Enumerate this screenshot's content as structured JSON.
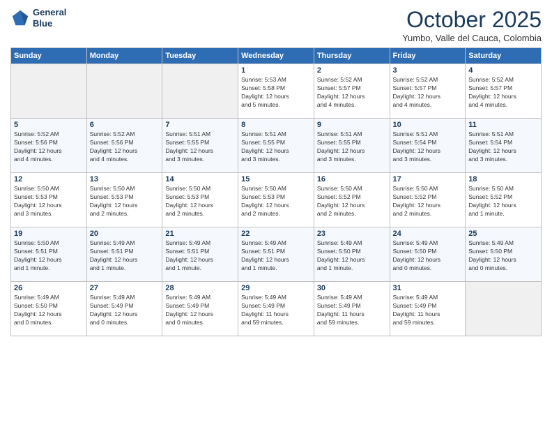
{
  "logo": {
    "line1": "General",
    "line2": "Blue"
  },
  "title": "October 2025",
  "subtitle": "Yumbo, Valle del Cauca, Colombia",
  "days_of_week": [
    "Sunday",
    "Monday",
    "Tuesday",
    "Wednesday",
    "Thursday",
    "Friday",
    "Saturday"
  ],
  "weeks": [
    [
      {
        "day": "",
        "detail": ""
      },
      {
        "day": "",
        "detail": ""
      },
      {
        "day": "",
        "detail": ""
      },
      {
        "day": "1",
        "detail": "Sunrise: 5:53 AM\nSunset: 5:58 PM\nDaylight: 12 hours\nand 5 minutes."
      },
      {
        "day": "2",
        "detail": "Sunrise: 5:52 AM\nSunset: 5:57 PM\nDaylight: 12 hours\nand 4 minutes."
      },
      {
        "day": "3",
        "detail": "Sunrise: 5:52 AM\nSunset: 5:57 PM\nDaylight: 12 hours\nand 4 minutes."
      },
      {
        "day": "4",
        "detail": "Sunrise: 5:52 AM\nSunset: 5:57 PM\nDaylight: 12 hours\nand 4 minutes."
      }
    ],
    [
      {
        "day": "5",
        "detail": "Sunrise: 5:52 AM\nSunset: 5:56 PM\nDaylight: 12 hours\nand 4 minutes."
      },
      {
        "day": "6",
        "detail": "Sunrise: 5:52 AM\nSunset: 5:56 PM\nDaylight: 12 hours\nand 4 minutes."
      },
      {
        "day": "7",
        "detail": "Sunrise: 5:51 AM\nSunset: 5:55 PM\nDaylight: 12 hours\nand 3 minutes."
      },
      {
        "day": "8",
        "detail": "Sunrise: 5:51 AM\nSunset: 5:55 PM\nDaylight: 12 hours\nand 3 minutes."
      },
      {
        "day": "9",
        "detail": "Sunrise: 5:51 AM\nSunset: 5:55 PM\nDaylight: 12 hours\nand 3 minutes."
      },
      {
        "day": "10",
        "detail": "Sunrise: 5:51 AM\nSunset: 5:54 PM\nDaylight: 12 hours\nand 3 minutes."
      },
      {
        "day": "11",
        "detail": "Sunrise: 5:51 AM\nSunset: 5:54 PM\nDaylight: 12 hours\nand 3 minutes."
      }
    ],
    [
      {
        "day": "12",
        "detail": "Sunrise: 5:50 AM\nSunset: 5:53 PM\nDaylight: 12 hours\nand 3 minutes."
      },
      {
        "day": "13",
        "detail": "Sunrise: 5:50 AM\nSunset: 5:53 PM\nDaylight: 12 hours\nand 2 minutes."
      },
      {
        "day": "14",
        "detail": "Sunrise: 5:50 AM\nSunset: 5:53 PM\nDaylight: 12 hours\nand 2 minutes."
      },
      {
        "day": "15",
        "detail": "Sunrise: 5:50 AM\nSunset: 5:53 PM\nDaylight: 12 hours\nand 2 minutes."
      },
      {
        "day": "16",
        "detail": "Sunrise: 5:50 AM\nSunset: 5:52 PM\nDaylight: 12 hours\nand 2 minutes."
      },
      {
        "day": "17",
        "detail": "Sunrise: 5:50 AM\nSunset: 5:52 PM\nDaylight: 12 hours\nand 2 minutes."
      },
      {
        "day": "18",
        "detail": "Sunrise: 5:50 AM\nSunset: 5:52 PM\nDaylight: 12 hours\nand 1 minute."
      }
    ],
    [
      {
        "day": "19",
        "detail": "Sunrise: 5:50 AM\nSunset: 5:51 PM\nDaylight: 12 hours\nand 1 minute."
      },
      {
        "day": "20",
        "detail": "Sunrise: 5:49 AM\nSunset: 5:51 PM\nDaylight: 12 hours\nand 1 minute."
      },
      {
        "day": "21",
        "detail": "Sunrise: 5:49 AM\nSunset: 5:51 PM\nDaylight: 12 hours\nand 1 minute."
      },
      {
        "day": "22",
        "detail": "Sunrise: 5:49 AM\nSunset: 5:51 PM\nDaylight: 12 hours\nand 1 minute."
      },
      {
        "day": "23",
        "detail": "Sunrise: 5:49 AM\nSunset: 5:50 PM\nDaylight: 12 hours\nand 1 minute."
      },
      {
        "day": "24",
        "detail": "Sunrise: 5:49 AM\nSunset: 5:50 PM\nDaylight: 12 hours\nand 0 minutes."
      },
      {
        "day": "25",
        "detail": "Sunrise: 5:49 AM\nSunset: 5:50 PM\nDaylight: 12 hours\nand 0 minutes."
      }
    ],
    [
      {
        "day": "26",
        "detail": "Sunrise: 5:49 AM\nSunset: 5:50 PM\nDaylight: 12 hours\nand 0 minutes."
      },
      {
        "day": "27",
        "detail": "Sunrise: 5:49 AM\nSunset: 5:49 PM\nDaylight: 12 hours\nand 0 minutes."
      },
      {
        "day": "28",
        "detail": "Sunrise: 5:49 AM\nSunset: 5:49 PM\nDaylight: 12 hours\nand 0 minutes."
      },
      {
        "day": "29",
        "detail": "Sunrise: 5:49 AM\nSunset: 5:49 PM\nDaylight: 11 hours\nand 59 minutes."
      },
      {
        "day": "30",
        "detail": "Sunrise: 5:49 AM\nSunset: 5:49 PM\nDaylight: 11 hours\nand 59 minutes."
      },
      {
        "day": "31",
        "detail": "Sunrise: 5:49 AM\nSunset: 5:49 PM\nDaylight: 11 hours\nand 59 minutes."
      },
      {
        "day": "",
        "detail": ""
      }
    ]
  ]
}
